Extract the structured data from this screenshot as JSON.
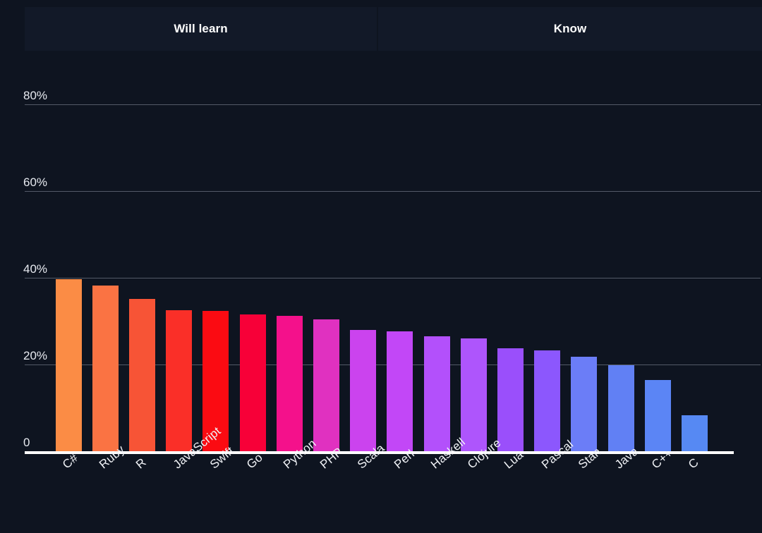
{
  "facets": {
    "left_label": "Will learn",
    "right_label": "Know"
  },
  "axis": {
    "y_ticks": [
      "80%",
      "60%",
      "40%",
      "20%",
      "0"
    ],
    "y_tick_values": [
      80,
      60,
      40,
      20,
      0
    ],
    "baseline_label": "0"
  },
  "chart_data": {
    "type": "bar",
    "title": "",
    "subtitle": "",
    "xlabel": "",
    "ylabel": "",
    "ylim": [
      0,
      88
    ],
    "grid": true,
    "grid_axis": "y",
    "legend_position": "none",
    "facet_labels": [
      "Will learn",
      "Know"
    ],
    "y_tick_labels": [
      "0",
      "20%",
      "40%",
      "60%",
      "80%"
    ],
    "y_tick_values": [
      0,
      20,
      40,
      60,
      80
    ],
    "categories": [
      "C#",
      "Ruby",
      "R",
      "JavaScript",
      "Swift",
      "Go",
      "Python",
      "PHP",
      "Scala",
      "Perl",
      "Haskell",
      "Clojure",
      "Lua",
      "Pascal",
      "Stan",
      "Java",
      "C++",
      "C"
    ],
    "values": [
      39.7,
      38.2,
      35.1,
      32.6,
      32.3,
      31.6,
      31.3,
      30.4,
      28.0,
      27.7,
      26.5,
      26.0,
      23.7,
      23.3,
      21.8,
      19.9,
      16.5,
      8.3
    ],
    "bar_colors": [
      "#fb8c45",
      "#fa7343",
      "#f75436",
      "#fa2f28",
      "#fb0b12",
      "#f70038",
      "#f4118b",
      "#e031c0",
      "#cb43ee",
      "#c247f7",
      "#b350fb",
      "#ae55fc",
      "#9a4ffb",
      "#8c57fd",
      "#6b7df7",
      "#6180f4",
      "#5b85f5",
      "#5689f3"
    ],
    "series": [
      {
        "name": "Will learn",
        "categories": [
          "C#",
          "Ruby",
          "R",
          "JavaScript",
          "Swift",
          "Go",
          "Python",
          "PHP",
          "Scala",
          "Perl",
          "Haskell",
          "Clojure",
          "Lua",
          "Pascal",
          "Stan",
          "Java",
          "C++",
          "C"
        ],
        "values": [
          39.7,
          38.2,
          35.1,
          32.6,
          32.3,
          31.6,
          31.3,
          30.4,
          28.0,
          27.7,
          26.5,
          26.0,
          23.7,
          23.3,
          21.8,
          19.9,
          16.5,
          8.3
        ]
      }
    ]
  },
  "colors": {
    "background": "#0e1420",
    "facet_panel": "#121928",
    "gridline": "#6b7280",
    "axis_line": "#ffffff",
    "text": "#f2f4f8"
  }
}
